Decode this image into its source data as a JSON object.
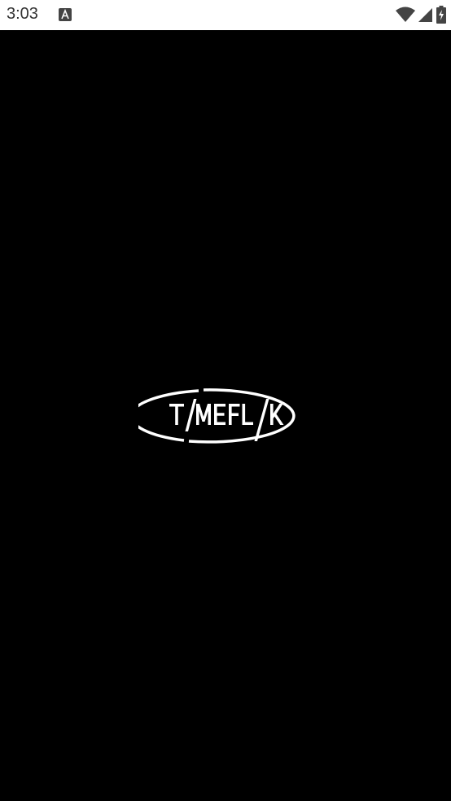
{
  "status_bar": {
    "time": "3:03",
    "icons": [
      "notification-a-icon",
      "wifi-icon",
      "signal-icon",
      "battery-charging-icon"
    ]
  },
  "splash": {
    "logo_text": "TIMEFLIK",
    "colors": {
      "background": "#000000",
      "logo": "#ffffff"
    }
  }
}
